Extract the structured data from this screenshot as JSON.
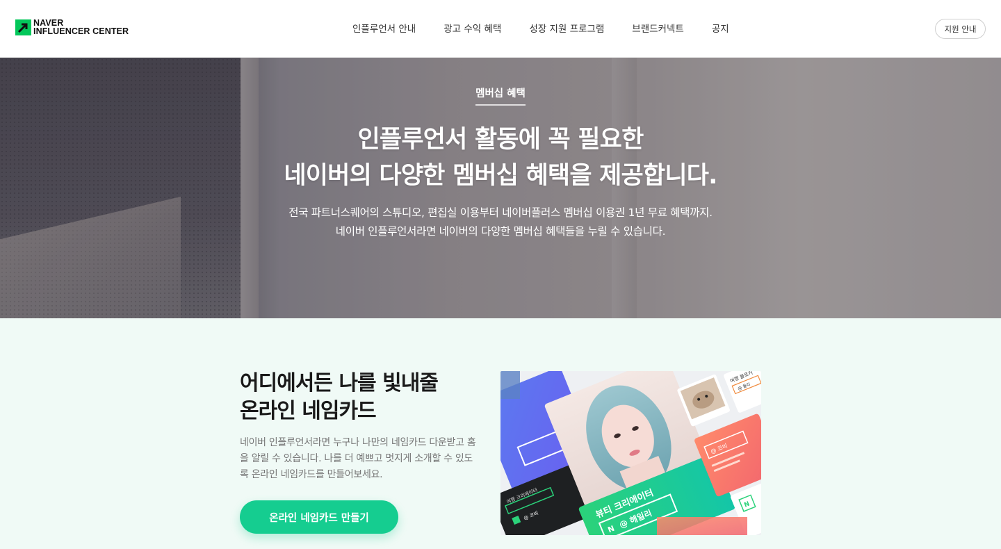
{
  "header": {
    "logo": {
      "line1": "NAVER",
      "line2": "INFLUENCER CENTER"
    },
    "nav": [
      {
        "label": "인플루언서 안내"
      },
      {
        "label": "광고 수익 혜택"
      },
      {
        "label": "성장 지원 프로그램"
      },
      {
        "label": "브랜드커넥트"
      },
      {
        "label": "공지"
      }
    ],
    "apply_button": "지원 안내"
  },
  "hero": {
    "tag": "멤버십 혜택",
    "title_line1": "인플루언서 활동에 꼭 필요한",
    "title_line2": "네이버의 다양한 멤버십 혜택을 제공합니다.",
    "desc_line1": "전국 파트너스퀘어의 스튜디오, 편집실 이용부터 네이버플러스 멤버십 이용권 1년 무료 혜택까지.",
    "desc_line2": "네이버 인플루언서라면 네이버의 다양한 멤버십 혜택들을 누릴 수 있습니다."
  },
  "namecard": {
    "title_line1": "어디에서든 나를 빛내줄",
    "title_line2": "온라인 네임카드",
    "desc": "네이버 인플루언서라면 누구나 나만의 네임카드 다운받고 홈을 알릴 수 있습니다. 나를 더 예쁘고 멋지게 소개할 수 있도록 온라인 네임카드를 만들어보세요.",
    "cta": "온라인 네임카드 만들기",
    "cards": {
      "main_category": "뷰티 크리에이터",
      "main_handle": "@ 헤일리",
      "left_category": "여행 크리에이터",
      "left_handle": "@ 코비",
      "right_handle": "@ 코비",
      "top_right_category": "여행 블로거",
      "top_right_handle": "@ 율리"
    }
  },
  "colors": {
    "accent": "#15cd90",
    "naver_green": "#03c75a",
    "section_bg": "#f0faf6"
  },
  "icons": {
    "logo": "naver-arrow-icon",
    "card_badge": "naver-n-icon"
  }
}
